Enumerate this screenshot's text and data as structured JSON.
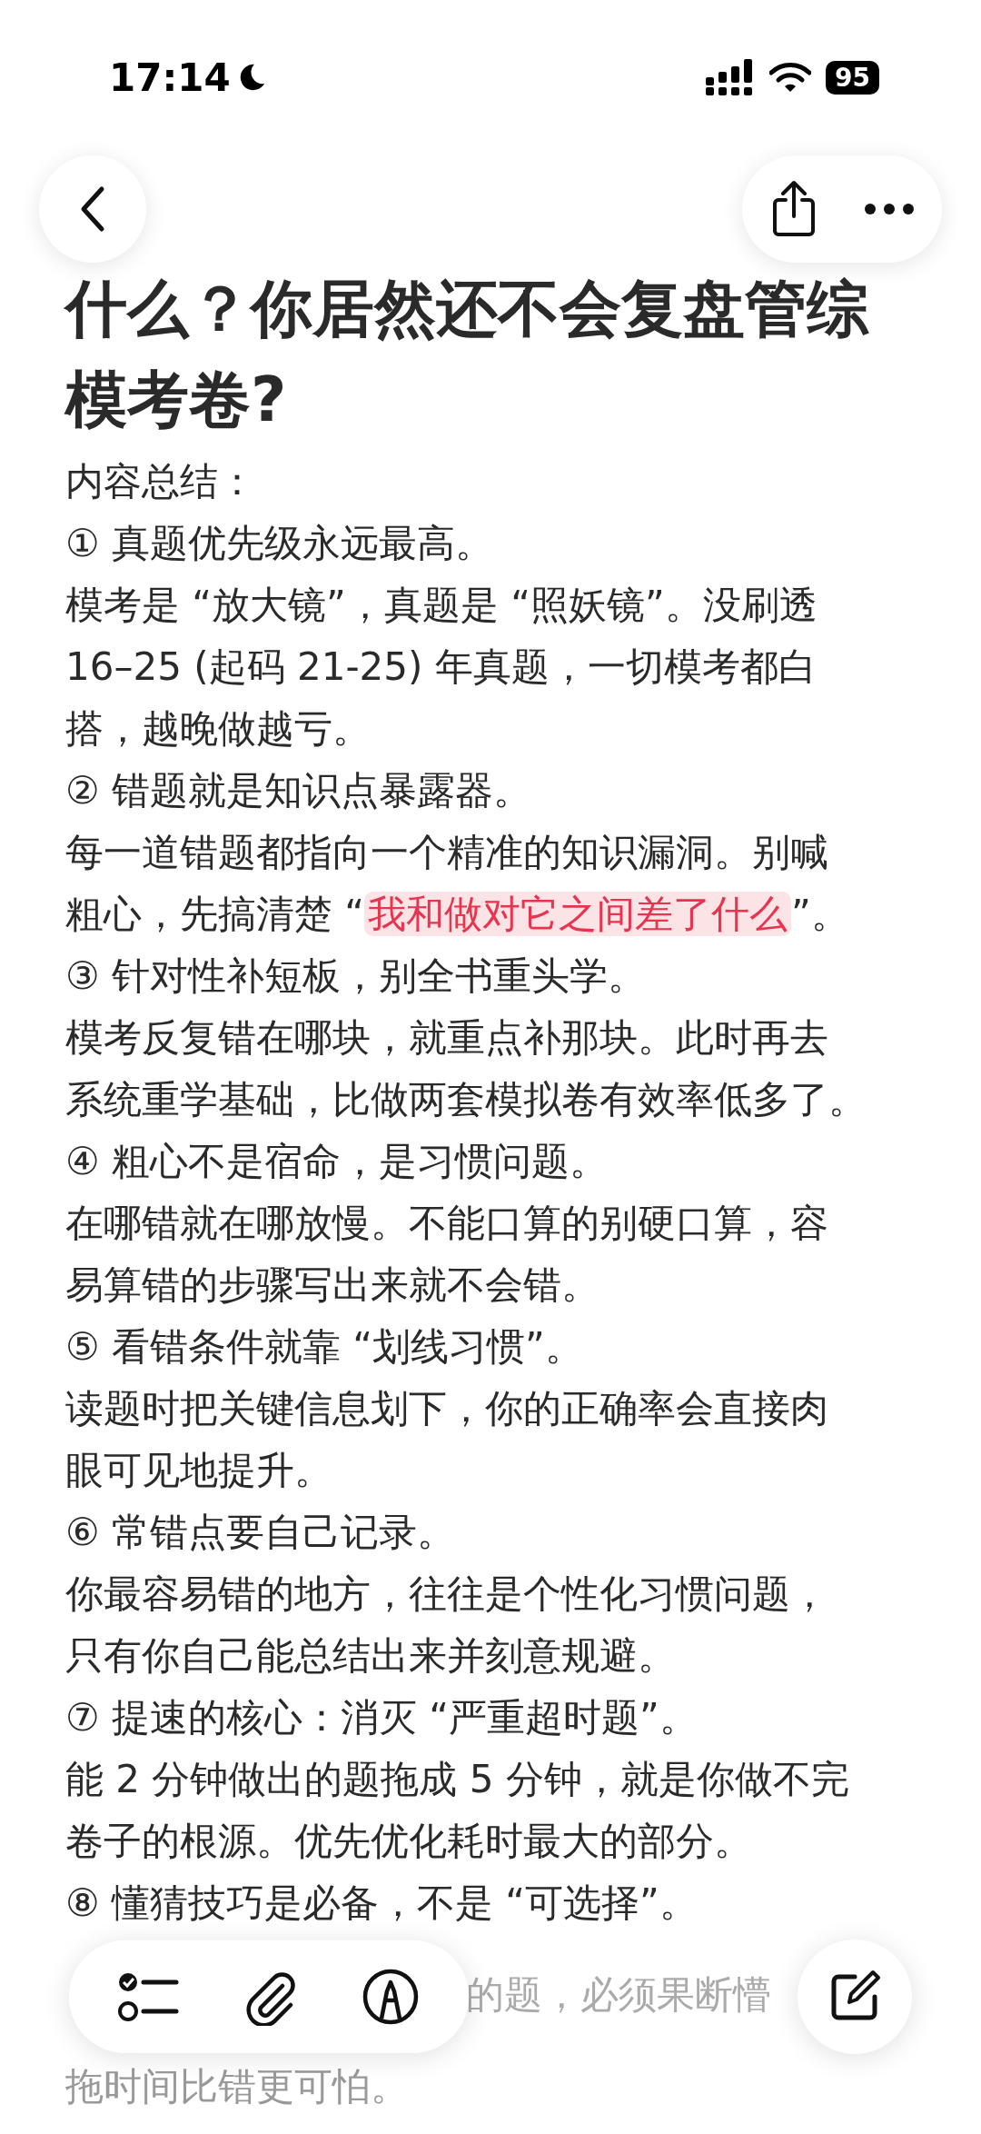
{
  "status_bar": {
    "time": "17:14",
    "battery": "95"
  },
  "title": "什么？你居然还不会复盘管综模考卷?",
  "lines": [
    {
      "text": "内容总结："
    },
    {
      "text": "① 真题优先级永远最高。"
    },
    {
      "text": "模考是 “放大镜”，真题是 “照妖镜”。没刷透"
    },
    {
      "text": "16–25 (起码 21-25) 年真题，一切模考都白"
    },
    {
      "text": "搭，越晚做越亏。"
    },
    {
      "text": "② 错题就是知识点暴露器。"
    },
    {
      "text": "每一道错题都指向一个精准的知识漏洞。别喊"
    },
    {
      "segments": [
        {
          "text": "粗心，先搞清楚 “",
          "highlight": false
        },
        {
          "text": "我和做对它之间差了什么",
          "highlight": true
        },
        {
          "text": "”。",
          "highlight": false
        }
      ]
    },
    {
      "text": "③ 针对性补短板，别全书重头学。"
    },
    {
      "text": "模考反复错在哪块，就重点补那块。此时再去"
    },
    {
      "text": "系统重学基础，比做两套模拟卷有效率低多了。"
    },
    {
      "text": "④ 粗心不是宿命，是习惯问题。"
    },
    {
      "text": "在哪错就在哪放慢。不能口算的别硬口算，容"
    },
    {
      "text": "易算错的步骤写出来就不会错。"
    },
    {
      "text": "⑤ 看错条件就靠 “划线习惯”。"
    },
    {
      "text": "读题时把关键信息划下，你的正确率会直接肉"
    },
    {
      "text": "眼可见地提升。"
    },
    {
      "text": "⑥ 常错点要自己记录。"
    },
    {
      "text": "你最容易错的地方，往往是个性化习惯问题，"
    },
    {
      "text": "只有你自己能总结出来并刻意规避。"
    },
    {
      "text": "⑦ 提速的核心：消灭 “严重超时题”。"
    },
    {
      "text": "能 2 分钟做出的题拖成 5 分钟，就是你做不完"
    },
    {
      "text": "卷子的根源。优先优化耗时最大的部分。"
    },
    {
      "text": "⑧ 懂猜技巧是必备，不是 “可选择”。"
    },
    {
      "text": "的题，必须果断懵",
      "kind": "obscured"
    },
    {
      "text": "拖时间比错更可怕。",
      "kind": "faded"
    }
  ]
}
